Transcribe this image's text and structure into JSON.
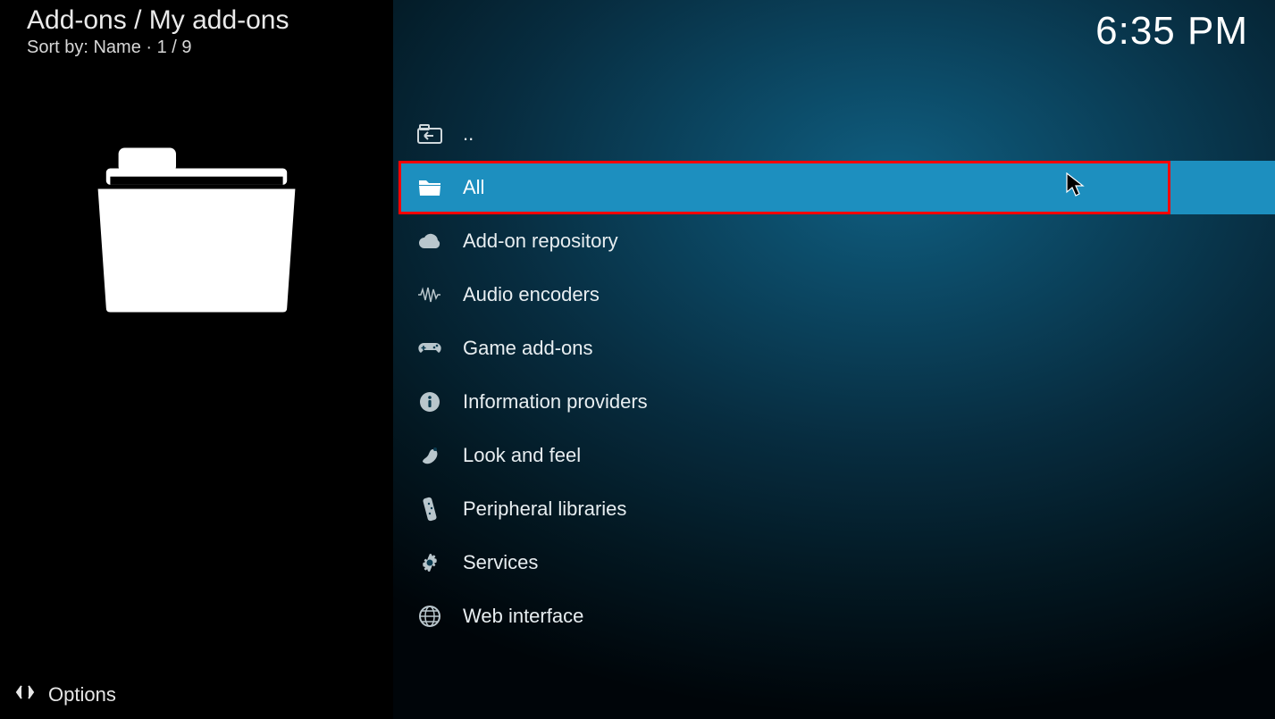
{
  "header": {
    "breadcrumb": "Add-ons / My add-ons",
    "sort_line": "Sort by: Name  ·  1 / 9"
  },
  "clock": "6:35 PM",
  "options_label": "Options",
  "list": {
    "back_label": "..",
    "items": [
      {
        "label": "All"
      },
      {
        "label": "Add-on repository"
      },
      {
        "label": "Audio encoders"
      },
      {
        "label": "Game add-ons"
      },
      {
        "label": "Information providers"
      },
      {
        "label": "Look and feel"
      },
      {
        "label": "Peripheral libraries"
      },
      {
        "label": "Services"
      },
      {
        "label": "Web interface"
      }
    ]
  }
}
